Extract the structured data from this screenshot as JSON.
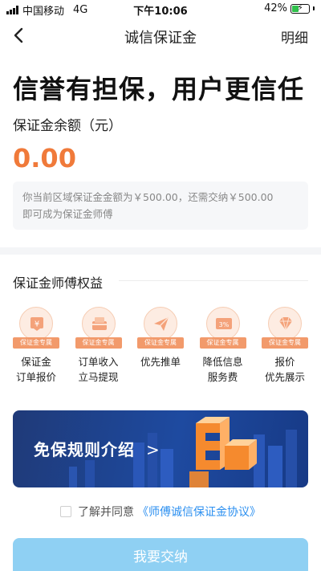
{
  "status_bar": {
    "carrier": "中国移动",
    "network": "4G",
    "time": "下午10:06",
    "battery": "42%",
    "battery_level": 0.42
  },
  "nav": {
    "title": "诚信保证金",
    "detail_label": "明细",
    "back_icon": "chevron-left-icon"
  },
  "hero": {
    "headline": "信誉有担保，用户更信任",
    "balance_label": "保证金余额（元）",
    "balance_value": "0.00"
  },
  "notice": {
    "line1": "你当前区域保证金金额为￥500.00，还需交纳￥500.00",
    "line2": "即可成为保证金师傅"
  },
  "benefits": {
    "title": "保证金师傅权益",
    "tag": "保证金专属",
    "items": [
      {
        "icon": "yen-card-icon",
        "label": "保证金\n订单报价"
      },
      {
        "icon": "cash-withdraw-icon",
        "label": "订单收入\n立马提现"
      },
      {
        "icon": "paper-plane-icon",
        "label": "优先推单"
      },
      {
        "icon": "percent-discount-icon",
        "label": "降低信息\n服务费",
        "badge": "3%"
      },
      {
        "icon": "diamond-icon",
        "label": "报价\n优先展示"
      }
    ]
  },
  "banner": {
    "text": "免保规则介绍",
    "arrow": ">"
  },
  "agreement": {
    "prefix": "了解并同意",
    "link": "《师傅诚信保证金协议》"
  },
  "submit": {
    "label": "我要交纳"
  },
  "colors": {
    "accent_orange": "#f07a3a",
    "link_blue": "#2b8ff0",
    "button_blue": "#8fd0f3",
    "banner_blue": "#1e4aa0"
  }
}
